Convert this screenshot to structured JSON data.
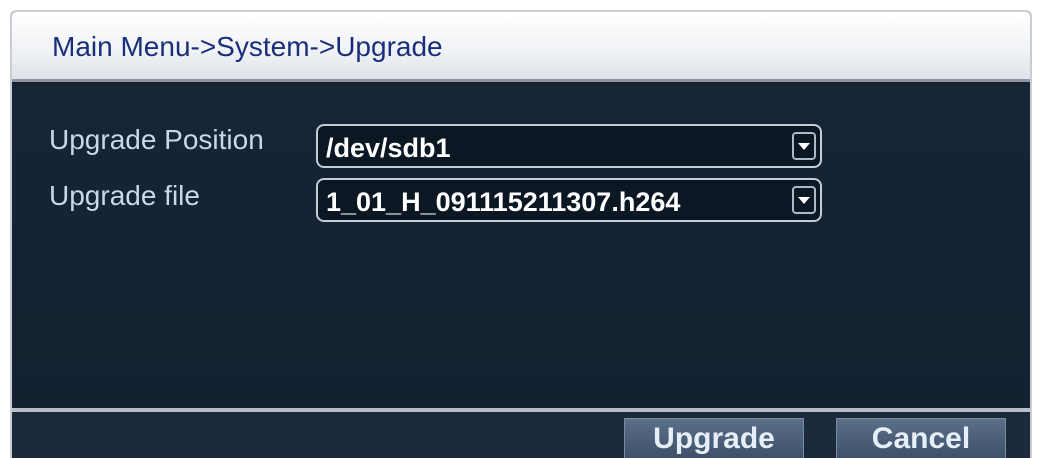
{
  "window": {
    "title": "Main Menu->System->Upgrade"
  },
  "form": {
    "position_label": "Upgrade Position",
    "position_value": "/dev/sdb1",
    "file_label": "Upgrade file",
    "file_value": "1_01_H_091115211307.h264"
  },
  "buttons": {
    "upgrade_label": "Upgrade",
    "cancel_label": "Cancel"
  },
  "colors": {
    "title_text": "#1a2f7a",
    "panel_bg": "#142131",
    "label_text": "#c8d7ec",
    "button_bg": "#4b5e79"
  }
}
